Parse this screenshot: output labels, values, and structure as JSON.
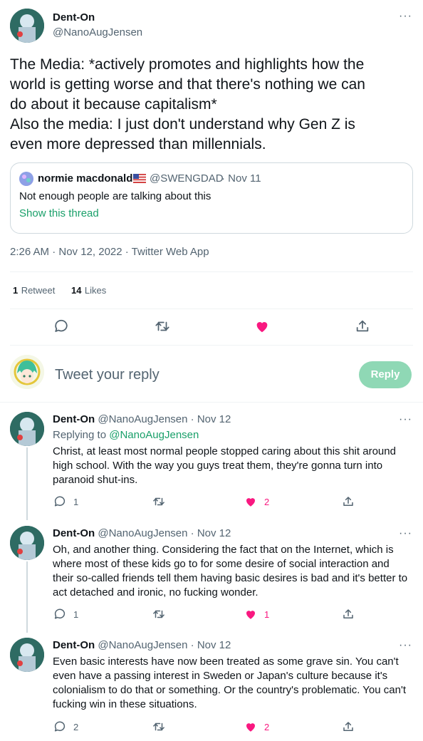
{
  "tweet": {
    "author_name": "Dent-On",
    "author_handle": "@NanoAugJensen",
    "more_label": "···",
    "text_line1": "The Media: *actively promotes and highlights how the",
    "text_line2": "world is getting worse and that there's nothing we can",
    "text_line3": "do about it because capitalism*",
    "text_line4": "Also the media: I just don't understand why Gen Z is",
    "text_line5": "even more depressed than millennials.",
    "timestamp": "2:26 AM · Nov 12, 2022 · Twitter Web App",
    "retweet_count": "1",
    "retweet_label": "Retweet",
    "like_count": "14",
    "like_label": "Likes"
  },
  "quoted": {
    "author_name": "normie macdonald",
    "author_handle": "@SWENGDAD",
    "date": "· Nov 11",
    "text": "Not enough people are talking about this",
    "show_thread": "Show this thread"
  },
  "compose": {
    "placeholder": "Tweet your reply",
    "button_label": "Reply"
  },
  "colors": {
    "accent": "#1aa06a",
    "like": "#f91880",
    "reply_button": "#8fd8b5"
  },
  "replies": [
    {
      "author_name": "Dent-On",
      "author_handle": "@NanoAugJensen",
      "date": "· Nov 12",
      "replying_prefix": "Replying to",
      "replying_handle": "@NanoAugJensen",
      "lines": [
        "Christ, at least most normal people stopped caring about this shit around",
        "high school. With the way you guys treat them, they're gonna turn into",
        "paranoid shut-ins."
      ],
      "reply_count": "1",
      "retweet_count": "",
      "like_count": "2"
    },
    {
      "author_name": "Dent-On",
      "author_handle": "@NanoAugJensen",
      "date": "· Nov 12",
      "lines": [
        "Oh, and another thing. Considering the fact that on the Internet, which is",
        "where most of these kids go to for some desire of social interaction and",
        "their so-called friends tell them having basic desires is bad and it's better to",
        "act detached and ironic, no fucking wonder."
      ],
      "reply_count": "1",
      "retweet_count": "",
      "like_count": "1"
    },
    {
      "author_name": "Dent-On",
      "author_handle": "@NanoAugJensen",
      "date": "· Nov 12",
      "lines": [
        "Even basic interests have now been treated as some grave sin. You can't",
        "even have a passing interest in Sweden or Japan's culture because it's",
        "colonialism to do that or something. Or the country's problematic. You can't",
        "fucking win in these situations."
      ],
      "reply_count": "2",
      "retweet_count": "",
      "like_count": "2"
    }
  ]
}
